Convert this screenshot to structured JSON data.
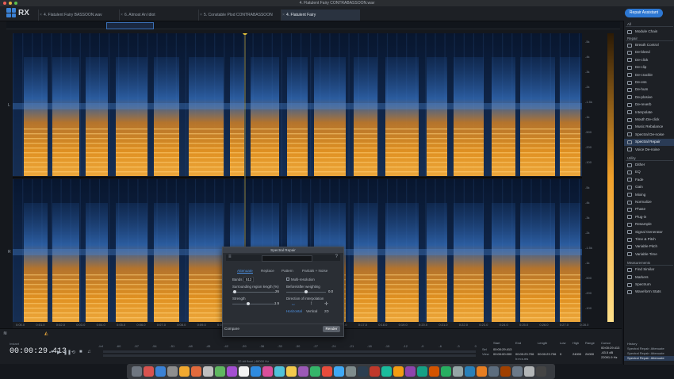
{
  "window": {
    "title": "4. Flatulent Fairy CONTRABASSOON.wav"
  },
  "app": {
    "logo_text": "RX"
  },
  "tabs": [
    {
      "label": "4. Flatulent Fairy BASSOON.wav",
      "active": false
    },
    {
      "label": "6. Almost An Idiot CONTRABASSOON.wav",
      "active": false
    },
    {
      "label": "5. Constable Plod CONTRABASSOON v2.wav",
      "active": false
    },
    {
      "label": "4. Flatulent Fairy CONTRABASSOON.wav",
      "active": true
    }
  ],
  "header": {
    "repair_assistant_label": "Repair Assistant"
  },
  "channels": {
    "left": "L",
    "right": "R"
  },
  "timeline": {
    "labels": [
      "0:00.0",
      "0:01.0",
      "0:02.0",
      "0:03.0",
      "0:04.0",
      "0:05.0",
      "0:06.0",
      "0:07.0",
      "0:08.0",
      "0:09.0",
      "0:10.0",
      "0:11.0",
      "0:12.0",
      "0:13.0",
      "0:14.0",
      "0:15.0",
      "0:16.0",
      "0:17.0",
      "0:18.0",
      "0:19.0",
      "0:20.0",
      "0:21.0",
      "0:22.0",
      "0:23.0",
      "0:24.0",
      "0:25.0",
      "0:26.0",
      "0:27.0",
      "0:28.0"
    ]
  },
  "freq_scale": [
    "-5k",
    "-4k",
    "-3k",
    "-2k",
    "-1.5k",
    "-1k",
    "-500",
    "-200",
    "-100"
  ],
  "transport": {
    "timecode_label": "Instant",
    "timecode": "00:00:29.413",
    "meter_scale": [
      "-Inf",
      "-60",
      "-57",
      "-54",
      "-51",
      "-48",
      "-45",
      "-42",
      "-39",
      "-36",
      "-33",
      "-30",
      "-27",
      "-24",
      "-21",
      "-18",
      "-15",
      "-12",
      "-9",
      "-6",
      "-3",
      "0"
    ],
    "status": "32-bit float | 48000 Hz"
  },
  "selection_info": {
    "headers": [
      "Start",
      "End",
      "Length",
      "Low",
      "High",
      "Range",
      "Cursor"
    ],
    "sel_label": "Sel",
    "view_label": "View",
    "sel": [
      "00:00:29.413",
      "",
      "",
      "",
      "",
      "",
      ""
    ],
    "view": [
      "00:00:00.000",
      "00:00:23.706",
      "00:00:23.706",
      "0",
      "24000",
      "24000",
      "-63.5 dB"
    ],
    "cursor_time": "00:00:29.413",
    "cursor_freq": "22091.9 Hz",
    "format_label": "h:m:s.ms"
  },
  "modules": {
    "list_label": "All",
    "chain_label": "Module Chain",
    "repair_section": "Repair",
    "repair": [
      "Breath Control",
      "De-bleed",
      "De-click",
      "De-clip",
      "De-crackle",
      "De-ess",
      "De-hum",
      "De-plosive",
      "De-reverb",
      "Interpolate",
      "Mouth De-click",
      "Music Rebalance",
      "Spectral De-noise",
      "Spectral Repair",
      "Voice De-noise"
    ],
    "selected": "Spectral Repair",
    "utility_section": "Utility",
    "utility": [
      "Dither",
      "EQ",
      "Fade",
      "Gain",
      "Mixing",
      "Normalize",
      "Phase",
      "Plug-in",
      "Resample",
      "Signal Generator",
      "Time & Pitch",
      "Variable Pitch",
      "Variable Time"
    ],
    "measurement_section": "Measurements",
    "measurement": [
      "Find Similar",
      "Markers",
      "Spectrum",
      "Waveform Stats"
    ]
  },
  "history": {
    "label": "History",
    "items": [
      "Spectral Repair: Attenuate",
      "Spectral Repair: Attenuate",
      "Spectral Repair: Attenuate"
    ]
  },
  "dialog": {
    "title": "Spectral Repair",
    "tabs": [
      "Attenuate",
      "Replace",
      "Pattern",
      "Partials + Noise"
    ],
    "bands_label": "Bands",
    "bands_value": "512",
    "multi_resolution_label": "Multi-resolution",
    "surrounding_label": "Surrounding region length (%)",
    "surrounding_value": "26",
    "before_after_label": "Before/after weighting",
    "before_after_value": "0.0",
    "strength_label": "Strength",
    "strength_value": "1.5",
    "direction_label": "Direction of interpolation",
    "directions": [
      "Horizontal",
      "Vertical",
      "2D"
    ],
    "compare_label": "Compare",
    "render_label": "Render"
  },
  "colors": {
    "accent": "#2d77d2",
    "spectro_low": "#0b1b3a",
    "spectro_mid": "#3f7fd0",
    "spectro_high": "#f0901c"
  }
}
